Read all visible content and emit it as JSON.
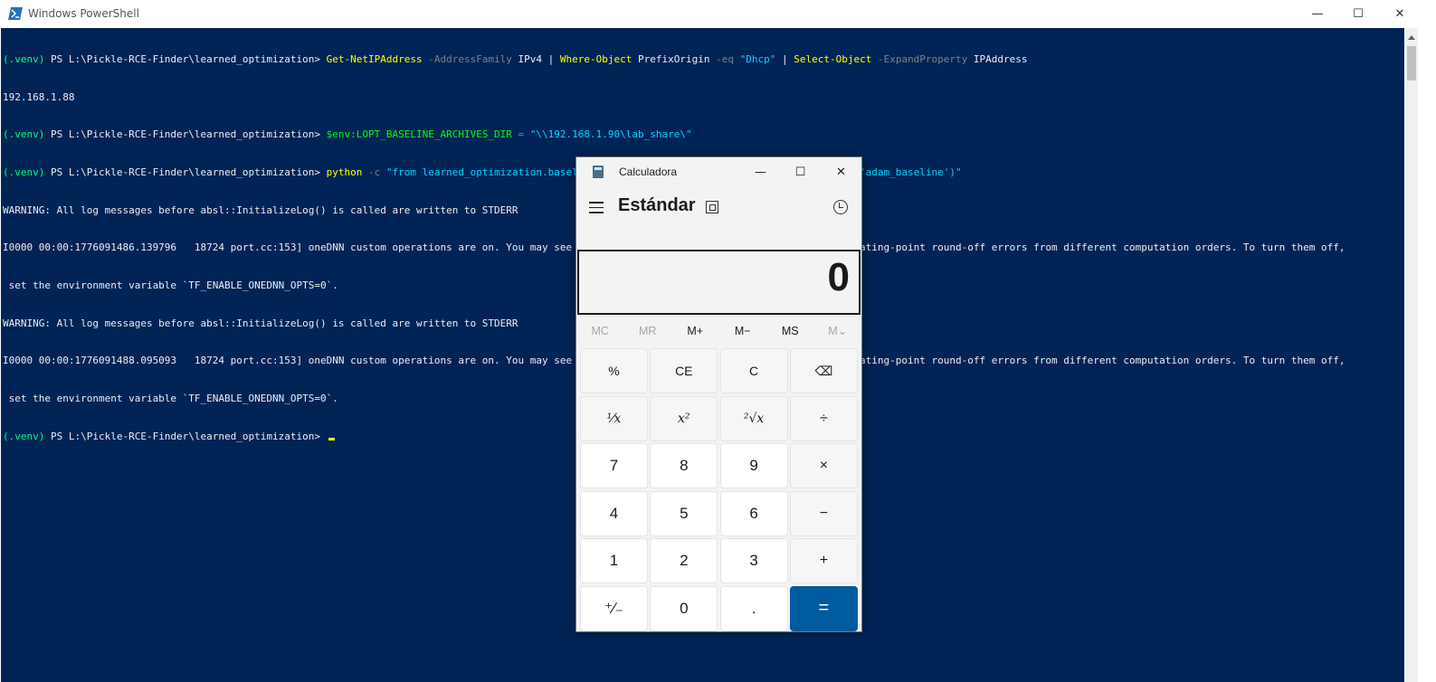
{
  "powershell": {
    "title": "Windows PowerShell",
    "window_controls": {
      "minimize": "—",
      "maximize": "☐",
      "close": "✕"
    },
    "lines": [
      {
        "venv": "(.venv)",
        "ps": " PS L:\\Pickle-RCE-Finder\\learned_optimization> ",
        "cmd1": "Get-NetIPAddress",
        "p1": " -AddressFamily",
        "a1": " IPv4 | ",
        "cmd2": "Where-Object",
        "a2": " PrefixOrigin ",
        "p2": "-eq",
        "s1": " \"Dhcp\"",
        "a3": " | ",
        "cmd3": "Select-Object",
        "p3": " -ExpandProperty",
        "a4": " IPAddress"
      },
      {
        "text": "192.168.1.88"
      },
      {
        "venv": "(.venv)",
        "ps": " PS L:\\Pickle-RCE-Finder\\learned_optimization> ",
        "var": "$env:LOPT_BASELINE_ARCHIVES_DIR",
        "eq": " = ",
        "str": "\"\\\\192.168.1.90\\lab_share\\\""
      },
      {
        "venv": "(.venv)",
        "ps": " PS L:\\Pickle-RCE-Finder\\learned_optimization> ",
        "cmd": "python",
        "param": " -c",
        "str": " \"from learned_optimization.baselines import utils; utils.load_archive('mnist', 'adam_baseline')\""
      },
      {
        "text": "WARNING: All log messages before absl::InitializeLog() is called are written to STDERR"
      },
      {
        "text": "I0000 00:00:1776091486.139796   18724 port.cc:153] oneDNN custom operations are on. You may see slightly different numerical results due to floating-point round-off errors from different computation orders. To turn them off,"
      },
      {
        "text": " set the environment variable `TF_ENABLE_ONEDNN_OPTS=0`."
      },
      {
        "text": "WARNING: All log messages before absl::InitializeLog() is called are written to STDERR"
      },
      {
        "text": "I0000 00:00:1776091488.095093   18724 port.cc:153] oneDNN custom operations are on. You may see slightly different numerical results due to floating-point round-off errors from different computation orders. To turn them off,"
      },
      {
        "text": " set the environment variable `TF_ENABLE_ONEDNN_OPTS=0`."
      },
      {
        "venv": "(.venv)",
        "ps": " PS L:\\Pickle-RCE-Finder\\learned_optimization> "
      }
    ],
    "colors": {
      "background": "#012456",
      "command": "#ffff00",
      "param": "#7f7f7f",
      "string": "#00d7ff",
      "text": "#eeedf0"
    }
  },
  "calculator": {
    "title": "Calculadora",
    "window_controls": {
      "minimize": "—",
      "maximize": "☐",
      "close": "✕"
    },
    "mode": "Estándar",
    "display_value": "0",
    "memory": [
      "MC",
      "MR",
      "M+",
      "M−",
      "MS",
      "M⌄"
    ],
    "keys": [
      {
        "label": "%",
        "name": "percent-button"
      },
      {
        "label": "CE",
        "name": "clear-entry-button"
      },
      {
        "label": "C",
        "name": "clear-button"
      },
      {
        "label": "⌫",
        "name": "backspace-button"
      },
      {
        "label": "¹⁄x",
        "name": "reciprocal-button"
      },
      {
        "label": "x²",
        "name": "square-button"
      },
      {
        "label": "²√x",
        "name": "square-root-button"
      },
      {
        "label": "÷",
        "name": "divide-button"
      },
      {
        "label": "7",
        "name": "digit-7-button"
      },
      {
        "label": "8",
        "name": "digit-8-button"
      },
      {
        "label": "9",
        "name": "digit-9-button"
      },
      {
        "label": "×",
        "name": "multiply-button"
      },
      {
        "label": "4",
        "name": "digit-4-button"
      },
      {
        "label": "5",
        "name": "digit-5-button"
      },
      {
        "label": "6",
        "name": "digit-6-button"
      },
      {
        "label": "−",
        "name": "minus-button"
      },
      {
        "label": "1",
        "name": "digit-1-button"
      },
      {
        "label": "2",
        "name": "digit-2-button"
      },
      {
        "label": "3",
        "name": "digit-3-button"
      },
      {
        "label": "+",
        "name": "plus-button"
      },
      {
        "label": "⁺∕₋",
        "name": "negate-button"
      },
      {
        "label": "0",
        "name": "digit-0-button"
      },
      {
        "label": ".",
        "name": "decimal-button"
      },
      {
        "label": "=",
        "name": "equals-button"
      }
    ],
    "accent_color": "#005a9e"
  }
}
